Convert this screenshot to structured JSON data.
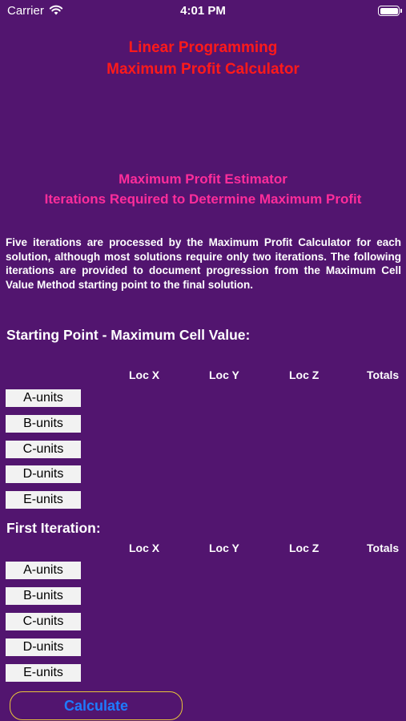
{
  "status_bar": {
    "carrier": "Carrier",
    "time": "4:01 PM"
  },
  "header": {
    "title_line1": "Linear Programming",
    "title_line2": "Maximum Profit Calculator",
    "subtitle_line1": "Maximum Profit Estimator",
    "subtitle_line2": "Iterations Required to Determine Maximum Profit"
  },
  "description": "Five iterations are processed by the Maximum Profit Calculator for each solution, although most solutions require only two iterations. The following iterations are provided to document progression from the Maximum Cell Value Method starting point to the final solution.",
  "columns": [
    "Loc X",
    "Loc Y",
    "Loc Z",
    "Totals"
  ],
  "sections": [
    {
      "heading": "Starting Point - Maximum Cell Value:",
      "units": [
        "A-units",
        "B-units",
        "C-units",
        "D-units",
        "E-units"
      ]
    },
    {
      "heading": "First Iteration:",
      "units": [
        "A-units",
        "B-units",
        "C-units",
        "D-units",
        "E-units"
      ]
    }
  ],
  "calculate_label": "Calculate",
  "colors": {
    "background": "#52156f",
    "title": "#ff1a1a",
    "subtitle": "#ff2d9b",
    "button_text": "#1e7bff",
    "button_border": "#e8c53a"
  },
  "icons": {
    "wifi": "wifi-icon",
    "battery": "battery-icon"
  }
}
